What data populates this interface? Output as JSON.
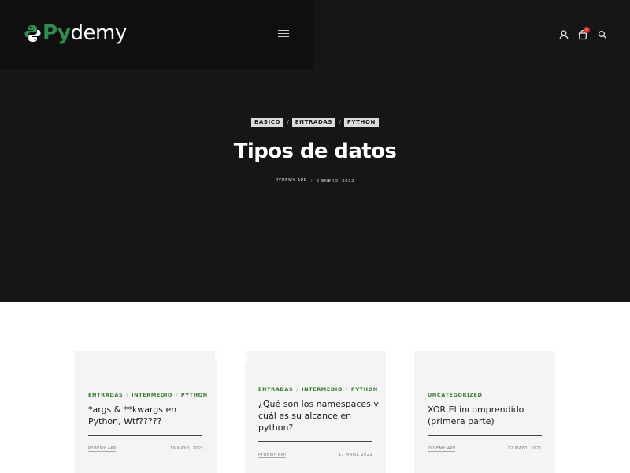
{
  "header": {
    "logo_py": "Py",
    "logo_rest": "demy",
    "cart_count": "0"
  },
  "hero": {
    "tags": [
      "BÁSICO",
      "ENTRADAS",
      "PYTHON"
    ],
    "tag_separator": "/",
    "title": "Tipos de datos",
    "author": "PYDEMY APP",
    "meta_separator": "/",
    "date": "6 ENERO, 2022"
  },
  "cards": [
    {
      "categories": [
        "ENTRADAS",
        "INTERMEDIO",
        "PYTHON"
      ],
      "title_line1": "*args & **kwargs en",
      "title_line2": "Python, Wtf?????",
      "author": "PYDEMY APP",
      "date": "19 MAYO, 2021"
    },
    {
      "categories": [
        "ENTRADAS",
        "INTERMEDIO",
        "PYTHON"
      ],
      "title_line1": "¿Qué son los namespaces y",
      "title_line2": "cuál es su alcance en",
      "title_line3": "python?",
      "author": "PYDEMY APP",
      "date": "17 MAYO, 2021"
    },
    {
      "categories": [
        "UNCATEGORIZED"
      ],
      "title_line1": "XOR El incomprendido",
      "title_line2": "(primera parte)",
      "author": "PYDEMY APP",
      "date": "12 MAYO, 2021"
    }
  ],
  "colors": {
    "brand_green": "#2f8d4e",
    "category_green": "#3a7a33",
    "hero_bg": "#161616",
    "badge_red": "#e02424"
  },
  "icons": [
    "python-logo-icon",
    "hamburger-menu-icon",
    "user-icon",
    "cart-icon",
    "search-icon"
  ]
}
